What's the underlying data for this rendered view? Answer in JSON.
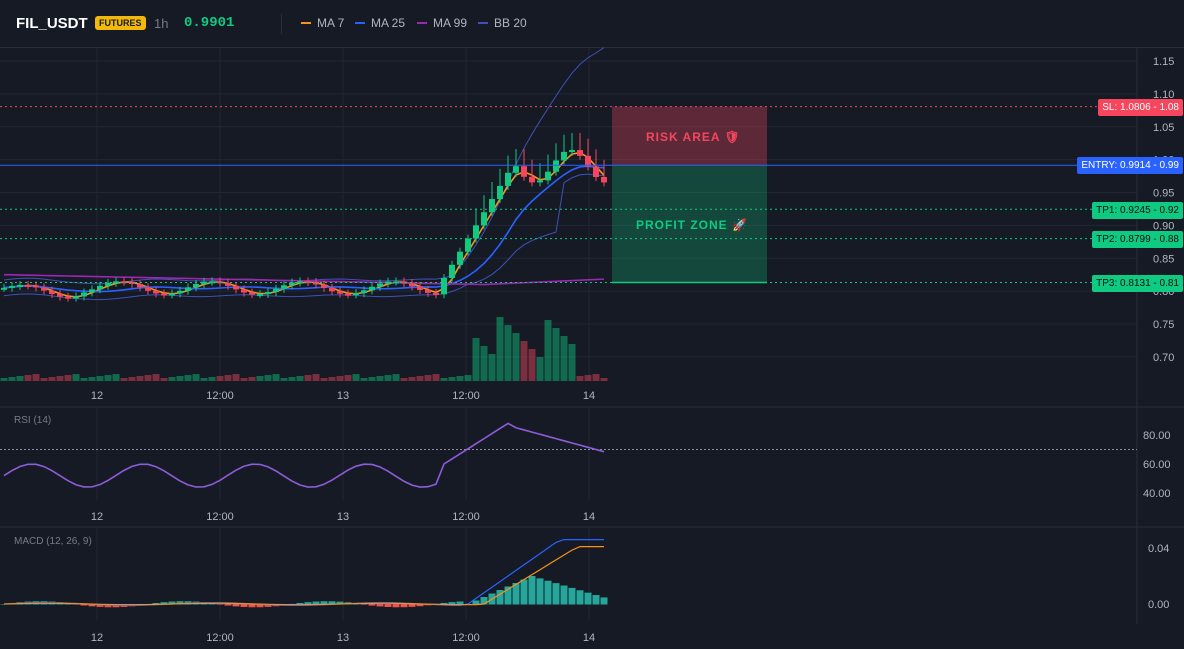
{
  "header": {
    "symbol": "FIL_USDT",
    "badge": "FUTURES",
    "timeframe": "1h",
    "last_price": "0.9901",
    "legend": [
      {
        "label": "MA 7",
        "color": "#f7931a"
      },
      {
        "label": "MA 25",
        "color": "#2962ff"
      },
      {
        "label": "MA 99",
        "color": "#9c27b0"
      },
      {
        "label": "BB 20",
        "color": "#3f51b5"
      }
    ]
  },
  "colors": {
    "up": "#0ecb81",
    "down": "#f6465d",
    "bg": "#161a25",
    "grid": "#232735"
  },
  "price_axis": {
    "ticks": [
      "1.15",
      "1.10",
      "1.05",
      "1.00",
      "0.95",
      "0.90",
      "0.85",
      "0.80",
      "0.75",
      "0.70"
    ]
  },
  "time_axis": {
    "ticks": [
      "12",
      "12:00",
      "13",
      "12:00",
      "14"
    ]
  },
  "levels": {
    "sl": {
      "label": "SL: 1.0806",
      "axis": "1.08",
      "value": 1.0806
    },
    "entry": {
      "label": "ENTRY: 0.9914",
      "axis": "0.99",
      "value": 0.9914
    },
    "tp1": {
      "label": "TP1: 0.9245",
      "axis": "0.92",
      "value": 0.9245
    },
    "tp2": {
      "label": "TP2: 0.8799",
      "axis": "0.88",
      "value": 0.8799
    },
    "tp3": {
      "label": "TP3: 0.8131",
      "axis": "0.81",
      "value": 0.8131
    }
  },
  "zones": {
    "risk": "RISK AREA 🛡",
    "profit": "PROFIT ZONE 🚀"
  },
  "rsi": {
    "label": "RSI (14)",
    "ticks": [
      "80.00",
      "60.00",
      "40.00"
    ]
  },
  "macd": {
    "label": "MACD (12, 26, 9)",
    "ticks": [
      "0.04",
      "0.00"
    ]
  }
}
